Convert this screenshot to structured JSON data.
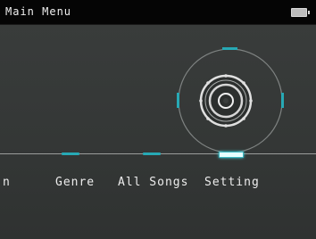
{
  "header": {
    "title": "Main Menu",
    "battery_icon": "battery-icon"
  },
  "menu": {
    "items": [
      {
        "label": "n",
        "selected": false
      },
      {
        "label": "Genre",
        "selected": false
      },
      {
        "label": "All Songs",
        "selected": false
      },
      {
        "label": "Setting",
        "selected": true
      }
    ],
    "selected_icon": "settings-dial-icon"
  },
  "colors": {
    "accent": "#27a9b5",
    "background": "#363938",
    "titlebar": "#050505",
    "text": "#ededed"
  }
}
